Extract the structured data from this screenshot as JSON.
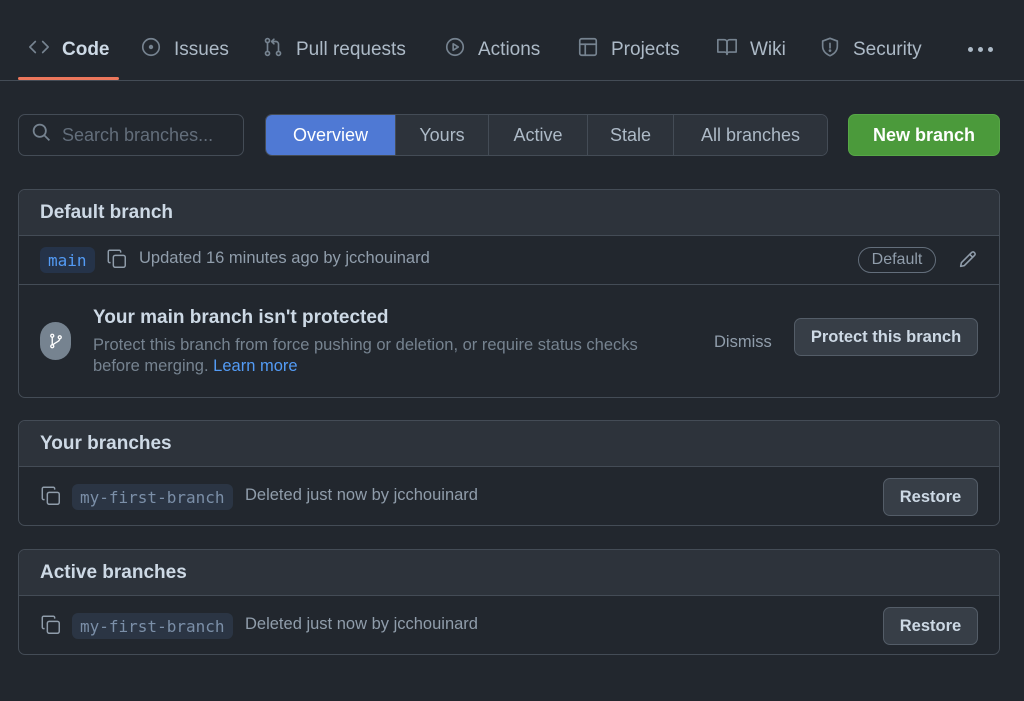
{
  "nav": {
    "items": [
      {
        "label": "Code",
        "icon": "code-icon"
      },
      {
        "label": "Issues",
        "icon": "issue-opened-icon"
      },
      {
        "label": "Pull requests",
        "icon": "git-pull-request-icon"
      },
      {
        "label": "Actions",
        "icon": "play-icon"
      },
      {
        "label": "Projects",
        "icon": "table-icon"
      },
      {
        "label": "Wiki",
        "icon": "book-icon"
      },
      {
        "label": "Security",
        "icon": "shield-icon"
      }
    ],
    "selected": "Code",
    "underline_color": "#ec775c"
  },
  "search": {
    "placeholder": "Search branches...",
    "value": ""
  },
  "tabs": {
    "items": [
      "Overview",
      "Yours",
      "Active",
      "Stale",
      "All branches"
    ],
    "selected": "Overview"
  },
  "new_branch_label": "New branch",
  "default_section": {
    "title": "Default branch",
    "branch": {
      "name": "main",
      "meta": "Updated 16 minutes ago by jcchouinard",
      "badge": "Default"
    },
    "protection": {
      "title": "Your main branch isn't protected",
      "description": "Protect this branch from force pushing or deletion, or require status checks before merging.",
      "link": "Learn more",
      "dismiss": "Dismiss",
      "action": "Protect this branch"
    }
  },
  "your_section": {
    "title": "Your branches",
    "branch": {
      "name": "my-first-branch",
      "meta": "Deleted just now by jcchouinard",
      "action": "Restore"
    }
  },
  "active_section": {
    "title": "Active branches",
    "branch": {
      "name": "my-first-branch",
      "meta": "Deleted just now by jcchouinard",
      "action": "Restore"
    }
  },
  "colors": {
    "background": "#22272e",
    "header_bg": "#2d333b",
    "accent_blue": "#4f79d4",
    "primary_green": "#4b9a3b",
    "link": "#539bf5"
  }
}
